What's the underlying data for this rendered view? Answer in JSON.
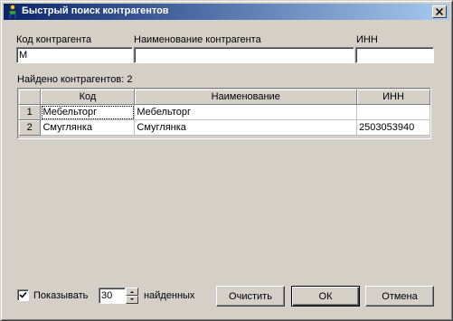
{
  "window": {
    "title": "Быстрый поиск контрагентов"
  },
  "filters": {
    "code_label": "Код контрагента",
    "code_value": "М",
    "name_label": "Наименование контрагента",
    "name_value": "",
    "inn_label": "ИНН",
    "inn_value": ""
  },
  "results": {
    "found_label": "Найдено контрагентов: 2",
    "columns": [
      "",
      "Код",
      "Наименование",
      "ИНН"
    ],
    "rows": [
      {
        "num": "1",
        "code": "Мебельторг",
        "name": "Мебельторг",
        "inn": ""
      },
      {
        "num": "2",
        "code": "Смуглянка",
        "name": "Смуглянка",
        "inn": "2503053940"
      }
    ]
  },
  "footer": {
    "show_checked": true,
    "show_label": "Показывать",
    "show_count": "30",
    "found_suffix": "найденных",
    "clear_label": "Очистить",
    "ok_label": "ОК",
    "cancel_label": "Отмена"
  }
}
